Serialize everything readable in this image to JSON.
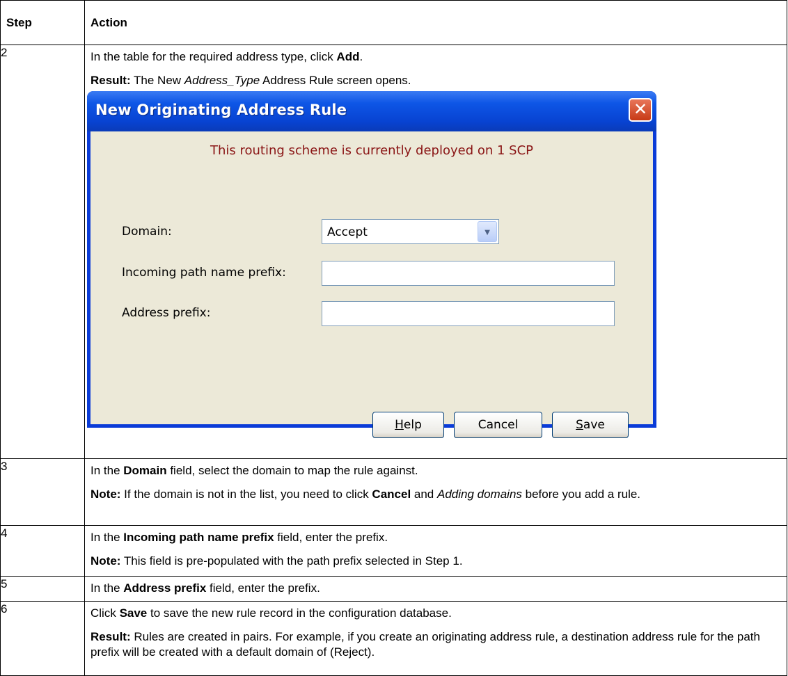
{
  "table": {
    "headers": {
      "step": "Step",
      "action": "Action"
    },
    "rows": [
      {
        "step": "2",
        "line1": {
          "pre": "In the table for the required address type, click ",
          "bold": "Add",
          "post": "."
        },
        "line2": {
          "label": "Result:",
          "pre": " The New ",
          "italic": "Address_Type",
          "post": " Address Rule screen opens."
        }
      },
      {
        "step": "3",
        "line1": {
          "pre": "In the ",
          "bold": "Domain",
          "post": " field, select the domain to map the rule against."
        },
        "line2": {
          "label": "Note:",
          "pre": " If the domain is not in the list, you need to click ",
          "bold": "Cancel",
          "mid": " and ",
          "italic": "Adding domains",
          "post": " before you add a rule."
        }
      },
      {
        "step": "4",
        "line1": {
          "pre": "In the ",
          "bold": "Incoming path name prefix",
          "post": " field, enter the prefix."
        },
        "line2": {
          "label": "Note:",
          "text": " This field is pre-populated with the path prefix selected in Step 1."
        }
      },
      {
        "step": "5",
        "line1": {
          "pre": "In the ",
          "bold": "Address prefix",
          "post": " field, enter the prefix."
        }
      },
      {
        "step": "6",
        "line1": {
          "pre": "Click ",
          "bold": "Save",
          "post": " to save the new rule record in the configuration database."
        },
        "line2": {
          "label": "Result:",
          "text": " Rules are created in pairs. For example, if you create an originating address rule, a destination address rule for the path prefix will be created with a default domain of (Reject)."
        }
      }
    ]
  },
  "dialog": {
    "title": "New Originating Address Rule",
    "notice": "This routing scheme is currently deployed on 1 SCP",
    "domain_label": "Domain:",
    "domain_value": "Accept",
    "incoming_label": "Incoming path name prefix:",
    "incoming_value": "",
    "address_label": "Address prefix:",
    "address_value": "",
    "buttons": {
      "help": {
        "mnemonic": "H",
        "rest": "elp"
      },
      "cancel": "Cancel",
      "save": {
        "mnemonic": "S",
        "rest": "ave"
      }
    },
    "colors": {
      "titlebar": "#0843d2",
      "client": "#ece9d8",
      "notice": "#8a1515",
      "close": "#c73a16"
    }
  }
}
